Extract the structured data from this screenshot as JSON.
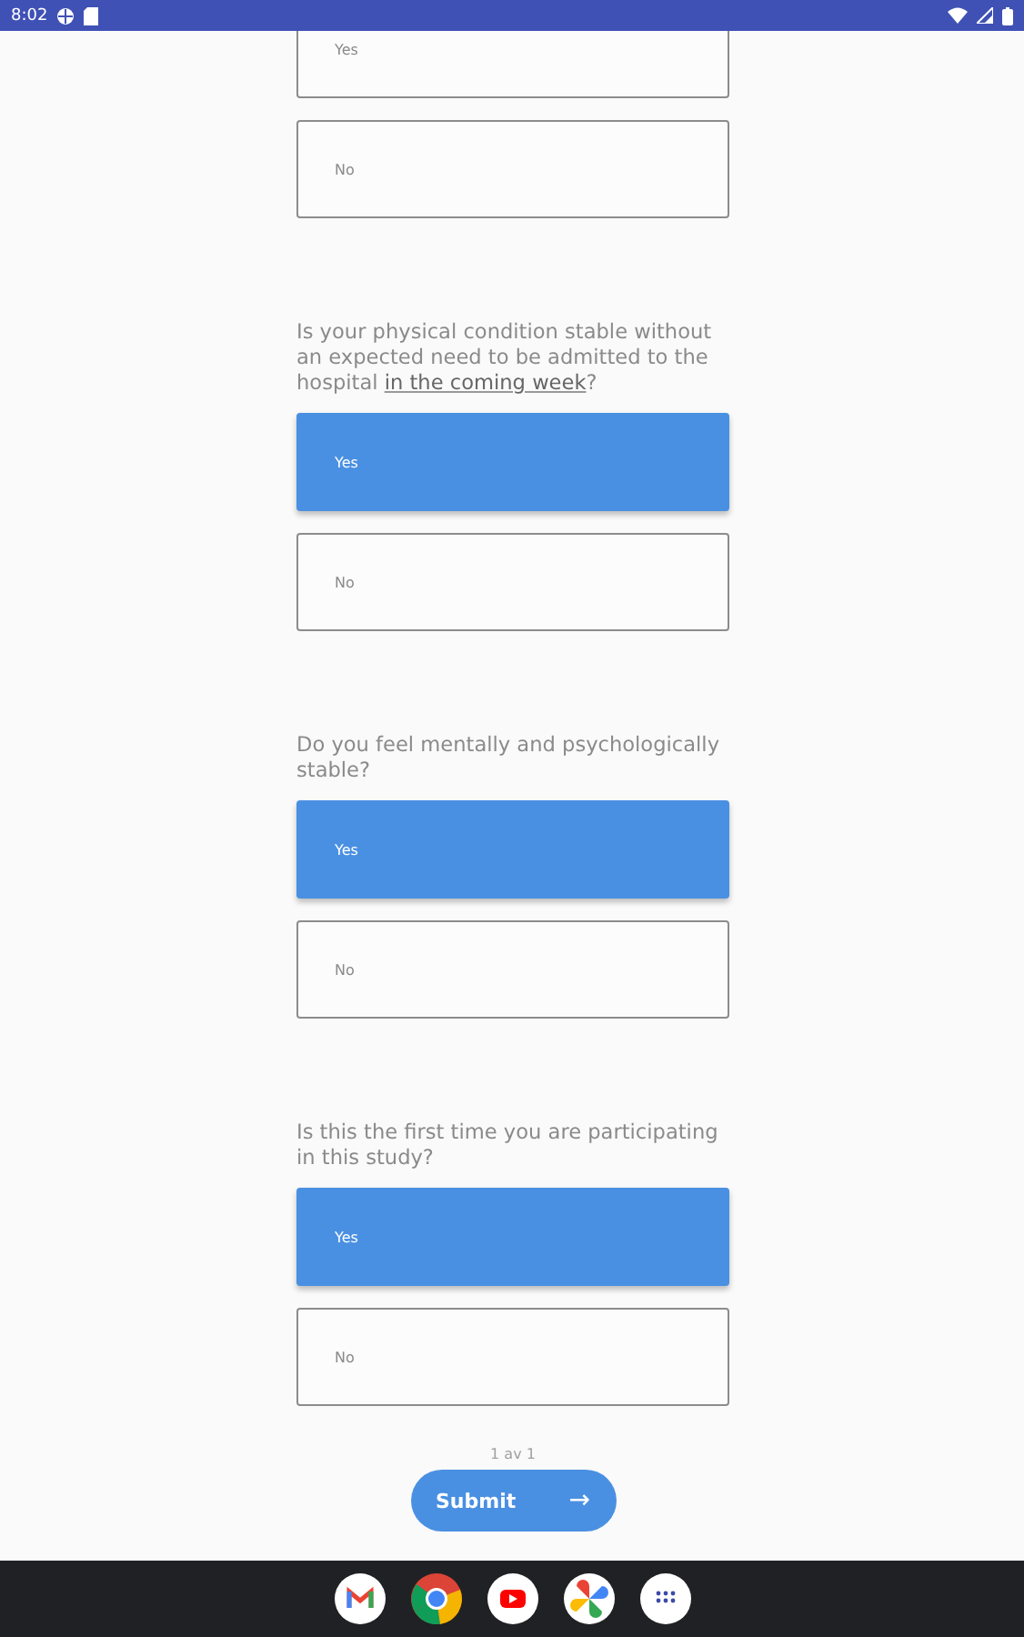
{
  "status_bar": {
    "time": "8:02"
  },
  "questions": [
    {
      "options": [
        {
          "label": "Yes",
          "selected": false
        },
        {
          "label": "No",
          "selected": false
        }
      ]
    },
    {
      "text": "Is your physical condition stable without an expected need to be admitted to the hospital **in the coming week**?",
      "options": [
        {
          "label": "Yes",
          "selected": true
        },
        {
          "label": "No",
          "selected": false
        }
      ]
    },
    {
      "text": "Do you feel mentally and psychologically stable?",
      "options": [
        {
          "label": "Yes",
          "selected": true
        },
        {
          "label": "No",
          "selected": false
        }
      ]
    },
    {
      "text": "Is this the first time you are participating in this study?",
      "options": [
        {
          "label": "Yes",
          "selected": true
        },
        {
          "label": "No",
          "selected": false
        }
      ]
    }
  ],
  "pagination": "1 av 1",
  "submit_button": {
    "label": "Submit",
    "arrow": "→"
  }
}
